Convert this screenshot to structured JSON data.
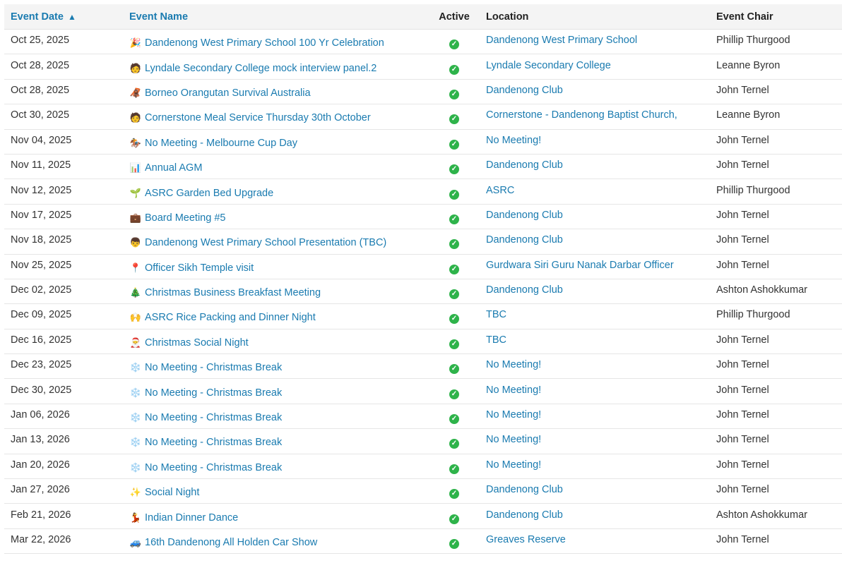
{
  "headers": {
    "date": "Event Date",
    "sort_arrow": "▲",
    "name": "Event Name",
    "active": "Active",
    "location": "Location",
    "chair": "Event Chair"
  },
  "colors": {
    "link": "#1a7bb0",
    "active_check": "#2eb34a"
  },
  "events": [
    {
      "date": "Oct 25, 2025",
      "icon": "party-popper-icon",
      "emoji": "🎉",
      "name": "Dandenong West Primary School 100 Yr Celebration",
      "location": "Dandenong West Primary School",
      "chair": "Phillip Thurgood"
    },
    {
      "date": "Oct 28, 2025",
      "icon": "person-icon",
      "emoji": "🧑",
      "name": "Lyndale Secondary College mock interview panel.2",
      "location": "Lyndale Secondary College",
      "chair": "Leanne Byron"
    },
    {
      "date": "Oct 28, 2025",
      "icon": "orangutan-icon",
      "emoji": "🦧",
      "name": "Borneo Orangutan Survival Australia",
      "location": "Dandenong Club",
      "chair": "John Ternel"
    },
    {
      "date": "Oct 30, 2025",
      "icon": "person-icon",
      "emoji": "🧑",
      "name": "Cornerstone Meal Service Thursday 30th October",
      "location": "Cornerstone - Dandenong Baptist Church,",
      "chair": "Leanne Byron"
    },
    {
      "date": "Nov 04, 2025",
      "icon": "horse-racing-icon",
      "emoji": "🏇",
      "name": "No Meeting - Melbourne Cup Day",
      "location": "No Meeting!",
      "chair": "John Ternel"
    },
    {
      "date": "Nov 11, 2025",
      "icon": "bar-chart-icon",
      "emoji": "📊",
      "name": "Annual AGM",
      "location": "Dandenong Club",
      "chair": "John Ternel"
    },
    {
      "date": "Nov 12, 2025",
      "icon": "seedling-icon",
      "emoji": "🌱",
      "name": "ASRC Garden Bed Upgrade",
      "location": "ASRC",
      "chair": "Phillip Thurgood"
    },
    {
      "date": "Nov 17, 2025",
      "icon": "briefcase-icon",
      "emoji": "💼",
      "name": "Board Meeting #5",
      "location": "Dandenong Club",
      "chair": "John Ternel"
    },
    {
      "date": "Nov 18, 2025",
      "icon": "child-icon",
      "emoji": "👦",
      "name": "Dandenong West Primary School Presentation (TBC)",
      "location": "Dandenong Club",
      "chair": "John Ternel"
    },
    {
      "date": "Nov 25, 2025",
      "icon": "map-pin-icon",
      "emoji": "📍",
      "name": "Officer Sikh Temple visit",
      "location": "Gurdwara Siri Guru Nanak Darbar Officer",
      "chair": "John Ternel"
    },
    {
      "date": "Dec 02, 2025",
      "icon": "christmas-tree-icon",
      "emoji": "🎄",
      "name": "Christmas Business Breakfast Meeting",
      "location": "Dandenong Club",
      "chair": "Ashton Ashokkumar"
    },
    {
      "date": "Dec 09, 2025",
      "icon": "raised-hands-icon",
      "emoji": "🙌",
      "name": "ASRC Rice Packing and Dinner Night",
      "location": "TBC",
      "chair": "Phillip Thurgood"
    },
    {
      "date": "Dec 16, 2025",
      "icon": "santa-icon",
      "emoji": "🎅",
      "name": "Christmas Social Night",
      "location": "TBC",
      "chair": "John Ternel"
    },
    {
      "date": "Dec 23, 2025",
      "icon": "snowflake-icon",
      "emoji": "❄️",
      "name": "No Meeting - Christmas Break",
      "location": "No Meeting!",
      "chair": "John Ternel"
    },
    {
      "date": "Dec 30, 2025",
      "icon": "snowflake-icon",
      "emoji": "❄️",
      "name": "No Meeting - Christmas Break",
      "location": "No Meeting!",
      "chair": "John Ternel"
    },
    {
      "date": "Jan 06, 2026",
      "icon": "snowflake-icon",
      "emoji": "❄️",
      "name": "No Meeting - Christmas Break",
      "location": "No Meeting!",
      "chair": "John Ternel"
    },
    {
      "date": "Jan 13, 2026",
      "icon": "snowflake-icon",
      "emoji": "❄️",
      "name": "No Meeting - Christmas Break",
      "location": "No Meeting!",
      "chair": "John Ternel"
    },
    {
      "date": "Jan 20, 2026",
      "icon": "snowflake-icon",
      "emoji": "❄️",
      "name": "No Meeting - Christmas Break",
      "location": "No Meeting!",
      "chair": "John Ternel"
    },
    {
      "date": "Jan 27, 2026",
      "icon": "sparkles-icon",
      "emoji": "✨",
      "name": "Social Night",
      "location": "Dandenong Club",
      "chair": "John Ternel"
    },
    {
      "date": "Feb 21, 2026",
      "icon": "dancer-icon",
      "emoji": "💃",
      "name": "Indian Dinner Dance",
      "location": "Dandenong Club",
      "chair": "Ashton Ashokkumar"
    },
    {
      "date": "Mar 22, 2026",
      "icon": "car-icon",
      "emoji": "🚙",
      "name": "16th Dandenong All Holden Car Show",
      "location": "Greaves Reserve",
      "chair": "John Ternel"
    }
  ]
}
